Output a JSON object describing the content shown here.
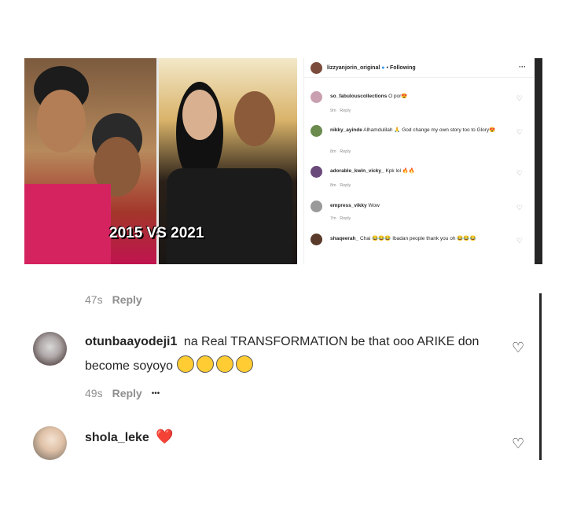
{
  "embedded_post": {
    "caption_overlay": "2015 VS 2021",
    "header": {
      "username": "lizzyanjorin_original",
      "following_label": "Following",
      "more_icon": "more-horizontal-icon"
    },
    "comments": [
      {
        "username": "so_fabulouscollections",
        "text": "O por😍",
        "time": "9m",
        "reply": "Reply"
      },
      {
        "username": "nikky_ayinde",
        "text": "Alhamdulilah 🙏 God change my own story too to Glory😍",
        "time": "8m",
        "reply": "Reply"
      },
      {
        "username": "adorable_kwin_vicky_",
        "text": "Kpk lol 🔥🔥",
        "time": "8m",
        "reply": "Reply"
      },
      {
        "username": "empress_vikky",
        "text": "Wow",
        "time": "7m",
        "reply": "Reply"
      },
      {
        "username": "shaqeerah_",
        "text": "Chai 😂😂😂 Ibadan people thank you oh 😂😂😂",
        "time": "",
        "reply": ""
      }
    ]
  },
  "thread": {
    "top_meta": {
      "time": "47s",
      "reply": "Reply"
    },
    "comments": [
      {
        "username": "otunbaayodeji1",
        "text": "na Real TRANSFORMATION be that ooo ARIKE don become soyoyo",
        "emoji_count": 4,
        "time": "49s",
        "reply": "Reply",
        "more": "•••"
      },
      {
        "username": "shola_leke",
        "text": "❤️"
      }
    ]
  },
  "icons": {
    "heart": "heart-outline-icon"
  },
  "colors": {
    "meta_gray": "#8e8e8e",
    "text": "#262626",
    "heart_red": "#e0245e"
  }
}
